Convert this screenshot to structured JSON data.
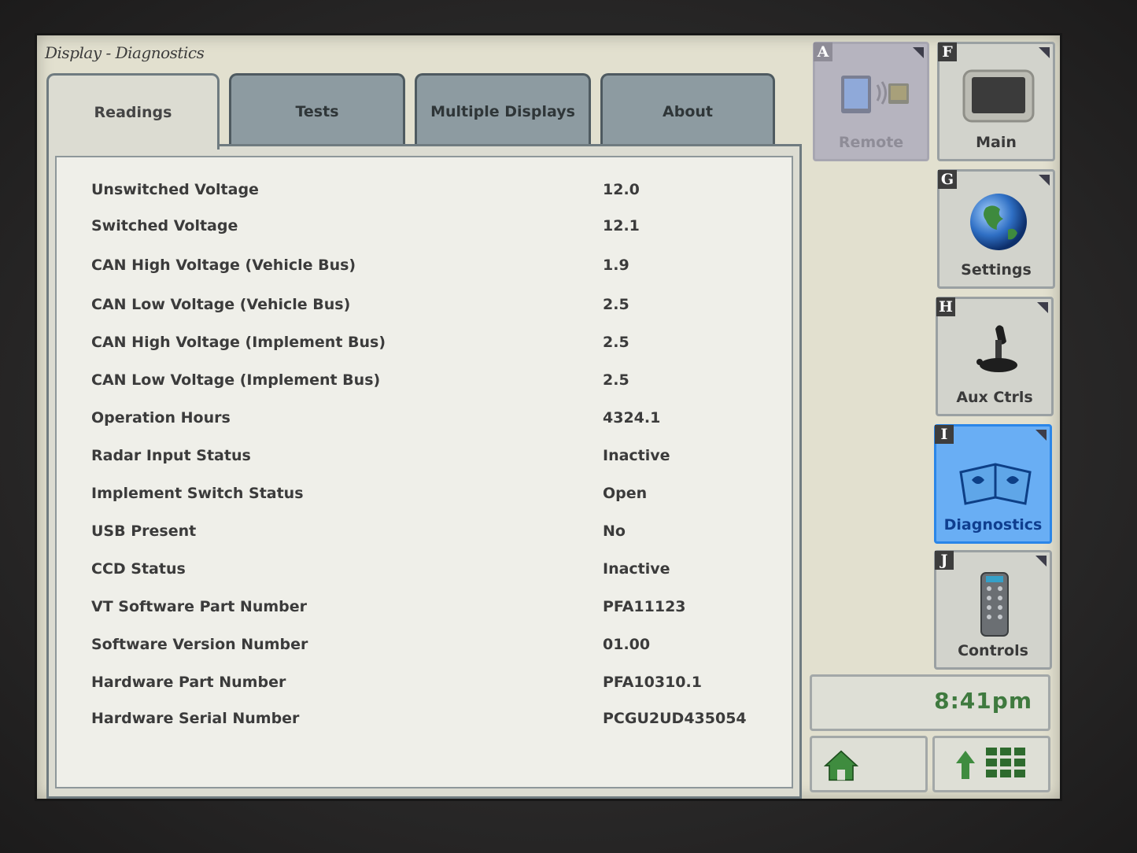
{
  "window": {
    "title": "Display - Diagnostics"
  },
  "tabs": [
    {
      "label": "Readings",
      "active": true
    },
    {
      "label": "Tests"
    },
    {
      "label": "Multiple Displays"
    },
    {
      "label": "About"
    }
  ],
  "readings": [
    {
      "label": "Unswitched Voltage",
      "value": "12.0"
    },
    {
      "label": "Switched Voltage",
      "value": "12.1"
    },
    {
      "label": "CAN High Voltage (Vehicle Bus)",
      "value": "1.9"
    },
    {
      "label": "CAN Low Voltage (Vehicle Bus)",
      "value": "2.5"
    },
    {
      "label": "CAN High Voltage (Implement Bus)",
      "value": "2.5"
    },
    {
      "label": "CAN Low Voltage (Implement Bus)",
      "value": "2.5"
    },
    {
      "label": "Operation Hours",
      "value": "4324.1"
    },
    {
      "label": "Radar Input Status",
      "value": "Inactive"
    },
    {
      "label": "Implement Switch Status",
      "value": "Open"
    },
    {
      "label": "USB Present",
      "value": "No"
    },
    {
      "label": "CCD Status",
      "value": "Inactive"
    },
    {
      "label": "VT Software Part Number",
      "value": "PFA11123"
    },
    {
      "label": "Software Version Number",
      "value": "01.00"
    },
    {
      "label": "Hardware Part Number",
      "value": "PFA10310.1"
    },
    {
      "label": "Hardware Serial Number",
      "value": "PCGU2UD435054"
    }
  ],
  "sidebar": {
    "remote": {
      "letter": "A",
      "label": "Remote",
      "icon": "remote-display-icon"
    },
    "main": {
      "letter": "F",
      "label": "Main",
      "icon": "display-icon"
    },
    "settings": {
      "letter": "G",
      "label": "Settings",
      "icon": "globe-icon"
    },
    "aux": {
      "letter": "H",
      "label": "Aux Ctrls",
      "icon": "joystick-icon"
    },
    "diagnostics": {
      "letter": "I",
      "label": "Diagnostics",
      "icon": "wrench-book-icon"
    },
    "controls": {
      "letter": "J",
      "label": "Controls",
      "icon": "remote-control-icon"
    }
  },
  "clock": {
    "time": "8:41pm"
  },
  "colors": {
    "active_accent": "#69aef4",
    "tab_inactive": "#8d9ba1",
    "clock_text": "#3f7a3f"
  }
}
